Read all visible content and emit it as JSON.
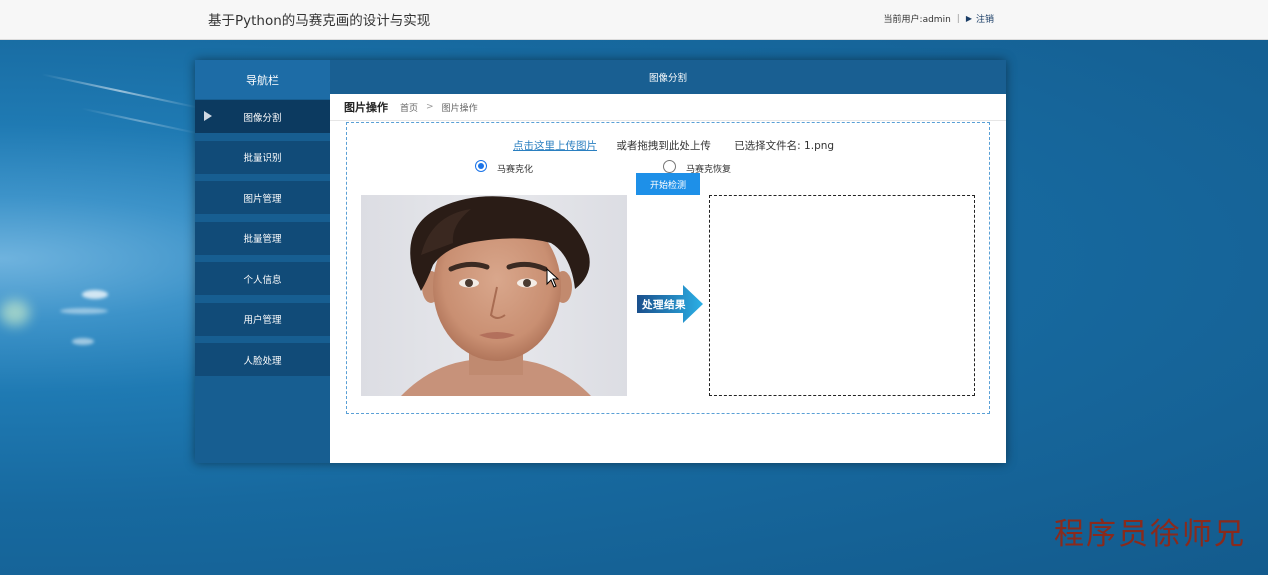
{
  "app": {
    "title": "基于Python的马赛克画的设计与实现",
    "current_user_label": "当前用户:admin",
    "separator": "|",
    "logout_label": "注销"
  },
  "sidebar": {
    "header": "导航栏",
    "items": [
      {
        "label": "图像分割",
        "active": true
      },
      {
        "label": "批量识别",
        "active": false
      },
      {
        "label": "图片管理",
        "active": false
      },
      {
        "label": "批量管理",
        "active": false
      },
      {
        "label": "个人信息",
        "active": false
      },
      {
        "label": "用户管理",
        "active": false
      },
      {
        "label": "人脸处理",
        "active": false
      }
    ]
  },
  "main": {
    "header": "图像分割",
    "page_title": "图片操作",
    "breadcrumb": {
      "home": "首页",
      "sep": ">",
      "current": "图片操作"
    }
  },
  "upload": {
    "link_label": "点击这里上传图片",
    "drag_hint": "或者拖拽到此处上传",
    "selected_file": "已选择文件名: 1.png"
  },
  "options": {
    "mosaic_label": "马赛克化",
    "restore_label": "马赛克恢复",
    "selected": "mosaic"
  },
  "actions": {
    "start_label": "开始检测"
  },
  "result": {
    "arrow_label": "处理结果"
  },
  "watermark": "程序员徐师兄",
  "colors": {
    "accent": "#1e90e8",
    "sidebar": "#175e91",
    "active_nav": "#0c3a60",
    "link": "#2a7fc0",
    "watermark": "#8a2a1c"
  }
}
